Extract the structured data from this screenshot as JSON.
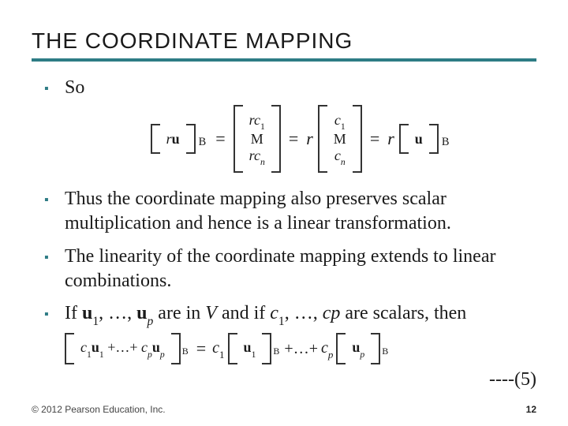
{
  "heading": "THE COORDINATE MAPPING",
  "bullets": {
    "b1": "So",
    "b2": "Thus the coordinate mapping also preserves scalar multiplication and hence is a linear transformation.",
    "b3": "The linearity of the coordinate mapping extends to linear combinations.",
    "b4_prefix": "If ",
    "b4_u1": "u",
    "b4_sub1": "1",
    "b4_mid1": ", …, ",
    "b4_up": "u",
    "b4_subp": "p",
    "b4_mid2": " are in ",
    "b4_V": "V",
    "b4_mid3": " and if ",
    "b4_c1": "c",
    "b4_csub1": "1",
    "b4_mid4": ", …, ",
    "b4_cp": "cp",
    "b4_tail": " are scalars, then"
  },
  "chart_data": {
    "type": "table",
    "equations": [
      {
        "name": "coordinate-mapping-scalar",
        "lhs": "[ r u ]_B",
        "steps": [
          "column_vector(r c_1, M, r c_n)",
          "r * column_vector(c_1, M, c_n)",
          "r * [ u ]_B"
        ]
      },
      {
        "name": "coordinate-mapping-linear-combination",
        "tag": "(5)",
        "lhs": "[ c_1 u_1 + … + c_p u_p ]_B",
        "rhs": "c_1 [ u_1 ]_B + … + c_p [ u_p ]_B"
      }
    ]
  },
  "eq1": {
    "r": "r",
    "u": "u",
    "B": "B",
    "rc1": "rc",
    "rc1_sub": "1",
    "rc_n": "rc",
    "rcn_sub": "n",
    "M": "M",
    "c1": "c",
    "c1_sub": "1",
    "cn": "c",
    "cn_sub": "n",
    "eq": "="
  },
  "eq5": {
    "lb_c1": "c",
    "lb_c1_sub": "1",
    "lb_u1": "u",
    "lb_u1_sub": "1",
    "plusdots": "+…+ ",
    "lb_cp": "c",
    "lb_cp_sub": "p",
    "lb_up": "u",
    "lb_up_sub": "p",
    "eq": "=",
    "B": "B",
    "r_c1": "c",
    "r_c1_sub": "1",
    "r_u1": "u",
    "r_u1_sub": "1",
    "r_cp": "c",
    "r_cp_sub": "p",
    "r_up": "u",
    "r_up_sub": "p",
    "tag": "----(5)"
  },
  "footer": {
    "copyright": "© 2012 Pearson Education, Inc.",
    "page": "12"
  }
}
